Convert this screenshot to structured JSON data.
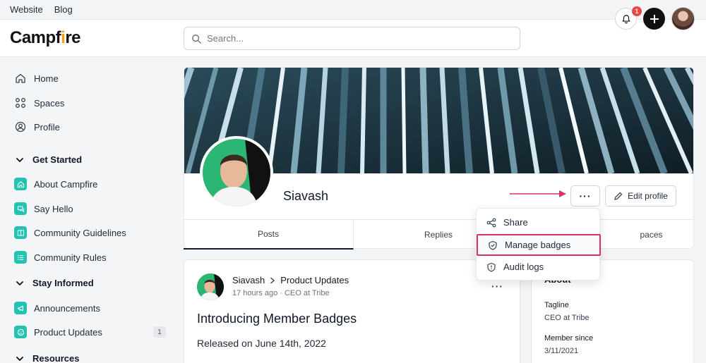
{
  "topbar": {
    "links": [
      "Website",
      "Blog"
    ]
  },
  "header": {
    "logo": {
      "text_a": "Campf",
      "text_b": "i",
      "text_c": "re"
    },
    "search": {
      "placeholder": "Search..."
    },
    "notifications": {
      "count": "1"
    }
  },
  "sidebar": {
    "primary": [
      {
        "label": "Home",
        "icon": "home-icon"
      },
      {
        "label": "Spaces",
        "icon": "grid-icon"
      },
      {
        "label": "Profile",
        "icon": "user-circle-icon"
      }
    ],
    "sections": [
      {
        "title": "Get Started",
        "items": [
          {
            "label": "About Campfire",
            "icon": "home-icon"
          },
          {
            "label": "Say Hello",
            "icon": "chat-icon"
          },
          {
            "label": "Community Guidelines",
            "icon": "book-icon"
          },
          {
            "label": "Community Rules",
            "icon": "list-icon"
          }
        ]
      },
      {
        "title": "Stay Informed",
        "items": [
          {
            "label": "Announcements",
            "icon": "megaphone-icon"
          },
          {
            "label": "Product Updates",
            "icon": "smile-icon",
            "badge": "1"
          }
        ]
      },
      {
        "title": "Resources",
        "items": []
      }
    ]
  },
  "profile": {
    "name": "Siavash",
    "edit_label": "Edit profile",
    "more_label": "···",
    "tabs": [
      "Posts",
      "Replies",
      "Spaces"
    ],
    "tab_spaces_visible": "paces",
    "active_tab": "Posts"
  },
  "menu": {
    "items": [
      {
        "label": "Share",
        "icon": "share-icon"
      },
      {
        "label": "Manage badges",
        "icon": "shield-icon",
        "highlighted": true
      },
      {
        "label": "Audit logs",
        "icon": "shield-icon"
      }
    ]
  },
  "post": {
    "author": "Siavash",
    "space": "Product Updates",
    "time": "17 hours ago · CEO at Tribe",
    "title": "Introducing Member Badges",
    "body": "Released on June 14th, 2022",
    "more_label": "···"
  },
  "about": {
    "title": "About",
    "fields": [
      {
        "label": "Tagline",
        "value": "CEO at Tribe"
      },
      {
        "label": "Member since",
        "value": "3/11/2021"
      }
    ]
  },
  "colors": {
    "accent_highlight": "#d6336c",
    "space_icon": "#22c3b1",
    "notification_badge": "#ef4444"
  }
}
